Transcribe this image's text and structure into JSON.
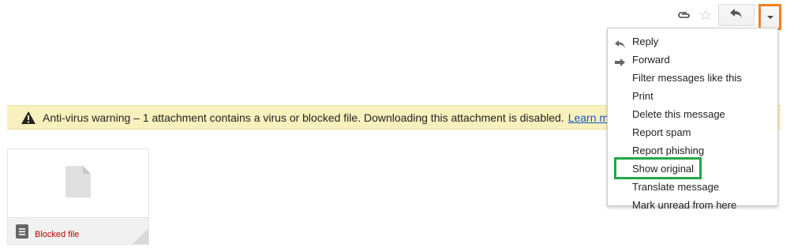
{
  "toolbar": {
    "icons": [
      "paperclip-icon",
      "star-icon",
      "reply-icon",
      "dropdown-arrow-icon"
    ],
    "more_highlight_color": "#f47e20"
  },
  "warning": {
    "message": "Anti-virus warning – 1 attachment contains a virus or blocked file. Downloading this attachment is disabled.",
    "link": "Learn more",
    "background": "#f9f1bd"
  },
  "attachment": {
    "name": "Blocked file"
  },
  "menu": {
    "items": [
      {
        "label": "Reply",
        "icon": "reply-icon"
      },
      {
        "label": "Forward",
        "icon": "forward-icon"
      },
      {
        "label": "Filter messages like this"
      },
      {
        "label": "Print"
      },
      {
        "label": "Delete this message"
      },
      {
        "label": "Report spam"
      },
      {
        "label": "Report phishing"
      },
      {
        "label": "Show original",
        "highlighted": true
      },
      {
        "label": "Translate message"
      },
      {
        "label": "Mark unread from here"
      }
    ],
    "highlight_color": "#22a845"
  }
}
